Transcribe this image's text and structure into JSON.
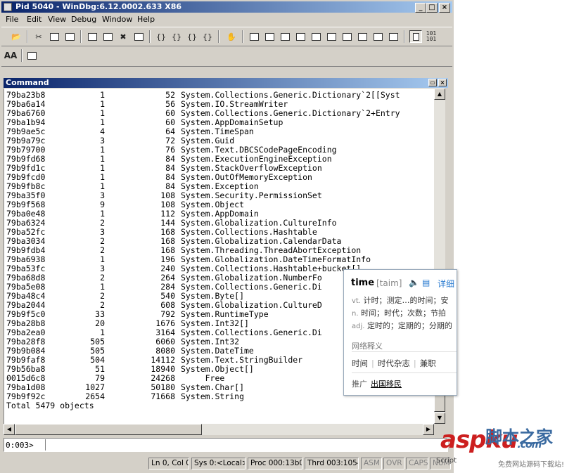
{
  "window": {
    "title": "Pid 5040 - WinDbg:6.12.0002.633 X86",
    "controls": {
      "minimize": "_",
      "maximize": "□",
      "close": "×"
    }
  },
  "menu": [
    "File",
    "Edit",
    "View",
    "Debug",
    "Window",
    "Help"
  ],
  "toolbar2": {
    "font_label": "AA"
  },
  "command_window": {
    "title": "Command",
    "rows": [
      {
        "mt": "79ba23b8",
        "count": "1",
        "size": "52",
        "class": "System.Collections.Generic.Dictionary`2[[Syst"
      },
      {
        "mt": "79ba6a14",
        "count": "1",
        "size": "56",
        "class": "System.IO.StreamWriter"
      },
      {
        "mt": "79ba6760",
        "count": "1",
        "size": "60",
        "class": "System.Collections.Generic.Dictionary`2+Entry"
      },
      {
        "mt": "79ba1b94",
        "count": "1",
        "size": "60",
        "class": "System.AppDomainSetup"
      },
      {
        "mt": "79b9ae5c",
        "count": "4",
        "size": "64",
        "class": "System.TimeSpan"
      },
      {
        "mt": "79b9a79c",
        "count": "3",
        "size": "72",
        "class": "System.Guid"
      },
      {
        "mt": "79b79700",
        "count": "1",
        "size": "76",
        "class": "System.Text.DBCSCodePageEncoding"
      },
      {
        "mt": "79b9fd68",
        "count": "1",
        "size": "84",
        "class": "System.ExecutionEngineException"
      },
      {
        "mt": "79b9fd1c",
        "count": "1",
        "size": "84",
        "class": "System.StackOverflowException"
      },
      {
        "mt": "79b9fcd0",
        "count": "1",
        "size": "84",
        "class": "System.OutOfMemoryException"
      },
      {
        "mt": "79b9fb8c",
        "count": "1",
        "size": "84",
        "class": "System.Exception"
      },
      {
        "mt": "79ba35f0",
        "count": "3",
        "size": "108",
        "class": "System.Security.PermissionSet"
      },
      {
        "mt": "79b9f568",
        "count": "9",
        "size": "108",
        "class": "System.Object"
      },
      {
        "mt": "79ba0e48",
        "count": "1",
        "size": "112",
        "class": "System.AppDomain"
      },
      {
        "mt": "79ba6324",
        "count": "2",
        "size": "144",
        "class": "System.Globalization.CultureInfo"
      },
      {
        "mt": "79ba52fc",
        "count": "3",
        "size": "168",
        "class": "System.Collections.Hashtable"
      },
      {
        "mt": "79ba3034",
        "count": "2",
        "size": "168",
        "class": "System.Globalization.CalendarData"
      },
      {
        "mt": "79b9fdb4",
        "count": "2",
        "size": "168",
        "class": "System.Threading.ThreadAbortException"
      },
      {
        "mt": "79ba6938",
        "count": "1",
        "size": "196",
        "class": "System.Globalization.DateTimeFormatInfo"
      },
      {
        "mt": "79ba53fc",
        "count": "3",
        "size": "240",
        "class": "System.Collections.Hashtable+bucket[]"
      },
      {
        "mt": "79ba68d8",
        "count": "2",
        "size": "264",
        "class": "System.Globalization.NumberFo"
      },
      {
        "mt": "79ba5e08",
        "count": "1",
        "size": "284",
        "class": "System.Collections.Generic.Di"
      },
      {
        "mt": "79ba48c4",
        "count": "2",
        "size": "540",
        "class": "System.Byte[]"
      },
      {
        "mt": "79ba2044",
        "count": "2",
        "size": "608",
        "class": "System.Globalization.CultureD"
      },
      {
        "mt": "79b9f5c0",
        "count": "33",
        "size": "792",
        "class": "System.RuntimeType"
      },
      {
        "mt": "79ba28b8",
        "count": "20",
        "size": "1676",
        "class": "System.Int32[]"
      },
      {
        "mt": "79ba2ea0",
        "count": "1",
        "size": "3164",
        "class": "System.Collections.Generic.Di"
      },
      {
        "mt": "79ba28f8",
        "count": "505",
        "size": "6060",
        "class": "System.Int32"
      },
      {
        "mt": "79b9b084",
        "count": "505",
        "size": "8080",
        "class": "System.DateTime"
      },
      {
        "mt": "79b9faf8",
        "count": "504",
        "size": "14112",
        "class": "System.Text.StringBuilder"
      },
      {
        "mt": "79b56ba8",
        "count": "51",
        "size": "18940",
        "class": "System.Object[]"
      },
      {
        "mt": "0015d6c8",
        "count": "79",
        "size": "24268",
        "class": "     Free"
      },
      {
        "mt": "79ba1d08",
        "count": "1027",
        "size": "50180",
        "class": "System.Char[]"
      },
      {
        "mt": "79b9f92c",
        "count": "2654",
        "size": "71668",
        "class": "System.String"
      }
    ],
    "total": "Total 5479 objects"
  },
  "prompt": {
    "label": "0:003>",
    "value": ""
  },
  "status_bar": {
    "position": "Ln 0, Col 0",
    "sys": "Sys 0:<Local>",
    "proc": "Proc 000:13b0",
    "thread": "Thrd 003:1054",
    "asm": "ASM",
    "ovr": "OVR",
    "caps": "CAPS",
    "num": "NUM"
  },
  "dictionary_popup": {
    "word": "time",
    "phonetic": "[taim]",
    "detail_link": "详细",
    "definitions": [
      {
        "pos": "vt.",
        "text": "计时；测定…的时间；安"
      },
      {
        "pos": "n.",
        "text": "时间；时代；次数；节拍"
      },
      {
        "pos": "adj.",
        "text": "定时的；定期的；分期的"
      }
    ],
    "net_label": "网络释义",
    "net_tags": [
      "时间",
      "时代杂志",
      "兼职"
    ],
    "promo_label": "推广",
    "promo_link": "出国移民"
  },
  "watermark": {
    "brand": "aspku",
    "brand_tail": ".com",
    "chinese": "脚本之家",
    "tagline": "免费网站源码下载站!",
    "script_label": "Script"
  }
}
